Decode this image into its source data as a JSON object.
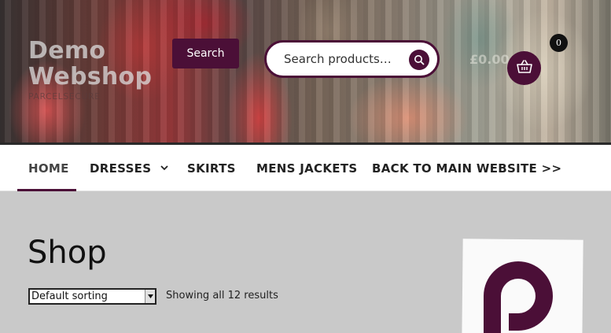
{
  "header": {
    "site_title_line1": "Demo",
    "site_title_line2": "Webshop",
    "tagline": "PARCELSECURE",
    "search_button_label": "Search",
    "search_placeholder": "Search products…",
    "cart_total": "£0.00",
    "cart_count": "0"
  },
  "nav": {
    "items": [
      {
        "label": "HOME",
        "active": true
      },
      {
        "label": "DRESSES",
        "has_submenu": true
      },
      {
        "label": "SKIRTS"
      },
      {
        "label": "MENS JACKETS"
      },
      {
        "label": "BACK TO MAIN WEBSITE >>"
      }
    ]
  },
  "main": {
    "title": "Shop",
    "sort_selected": "Default sorting",
    "result_count": "Showing all 12 results"
  },
  "colors": {
    "brand": "#4b0f37",
    "background": "#c9c9c9",
    "nav_background": "#ffffff"
  },
  "icons": {
    "search": "search-icon",
    "cart": "basket-icon",
    "submenu": "chevron-down-icon",
    "brand_logo": "p-logo"
  }
}
